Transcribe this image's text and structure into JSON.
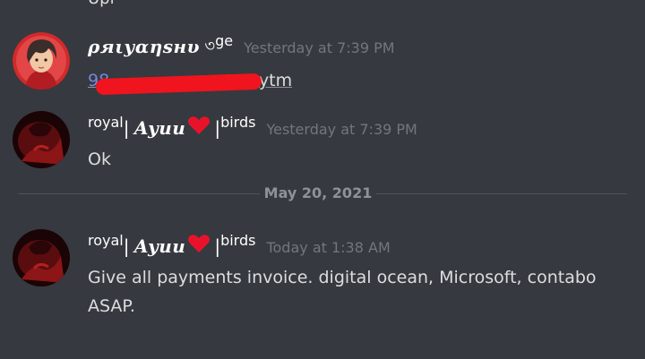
{
  "previous_message": {
    "text_fragment": "Upi"
  },
  "messages": [
    {
      "username": "ρяιуαηѕнυ",
      "username_suffix": "ge",
      "timestamp": "Yesterday at 7:39 PM",
      "content_prefix": "98",
      "content_suffix": "@paytm",
      "link_color": "#7289da",
      "redaction_color": "#f0141e"
    },
    {
      "username_prefix": "royal",
      "username_stylized": "Ayuu",
      "username_suffix": "birds",
      "heart_color": "#e8132b",
      "timestamp": "Yesterday at 7:39 PM",
      "content": "Ok"
    },
    {
      "username_prefix": "royal",
      "username_stylized": "Ayuu",
      "username_suffix": "birds",
      "heart_color": "#e8132b",
      "timestamp": "Today at 1:38 AM",
      "content": "Give all payments invoice. digital ocean, Microsoft, contabo ASAP."
    }
  ],
  "date_divider": "May 20, 2021",
  "colors": {
    "background": "#36393f",
    "username": "#ffffff",
    "timestamp": "#72767d",
    "message_text": "#dcddde"
  }
}
